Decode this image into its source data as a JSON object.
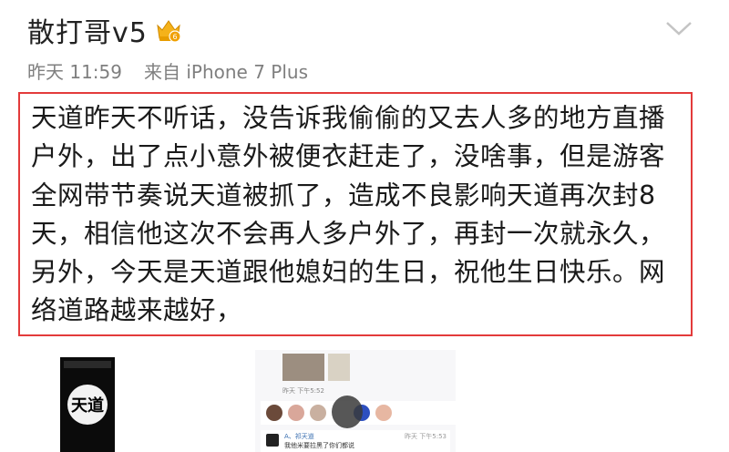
{
  "header": {
    "username": "散打哥v5",
    "vip_badge_icon": "crown-vip-icon",
    "menu_icon": "chevron-down-icon"
  },
  "meta": {
    "time": "昨天 11:59",
    "source": "来自 iPhone 7 Plus"
  },
  "post": {
    "text": "天道昨天不听话，没告诉我偷偷的又去人多的地方直播户外，出了点小意外被便衣赶走了，没啥事，但是游客全网带节奏说天道被抓了，造成不良影响天道再次封8天，相信他这次不会再人多户外了，再封一次就永久，另外，今天是天道跟他媳妇的生日，祝他生日快乐。网络道路越来越好，",
    "highlight_color": "#e33b3b"
  },
  "thumbnails": [
    {
      "name": "image-thumbnail-1",
      "logo_text": "天道"
    },
    {
      "name": "image-thumbnail-2",
      "chat_time_1": "昨天 下午5:52",
      "chat_sender": "A、祁天道",
      "chat_message": "我他米要拉黑了你们都说",
      "chat_time_2": "昨天 下午5:53"
    }
  ]
}
